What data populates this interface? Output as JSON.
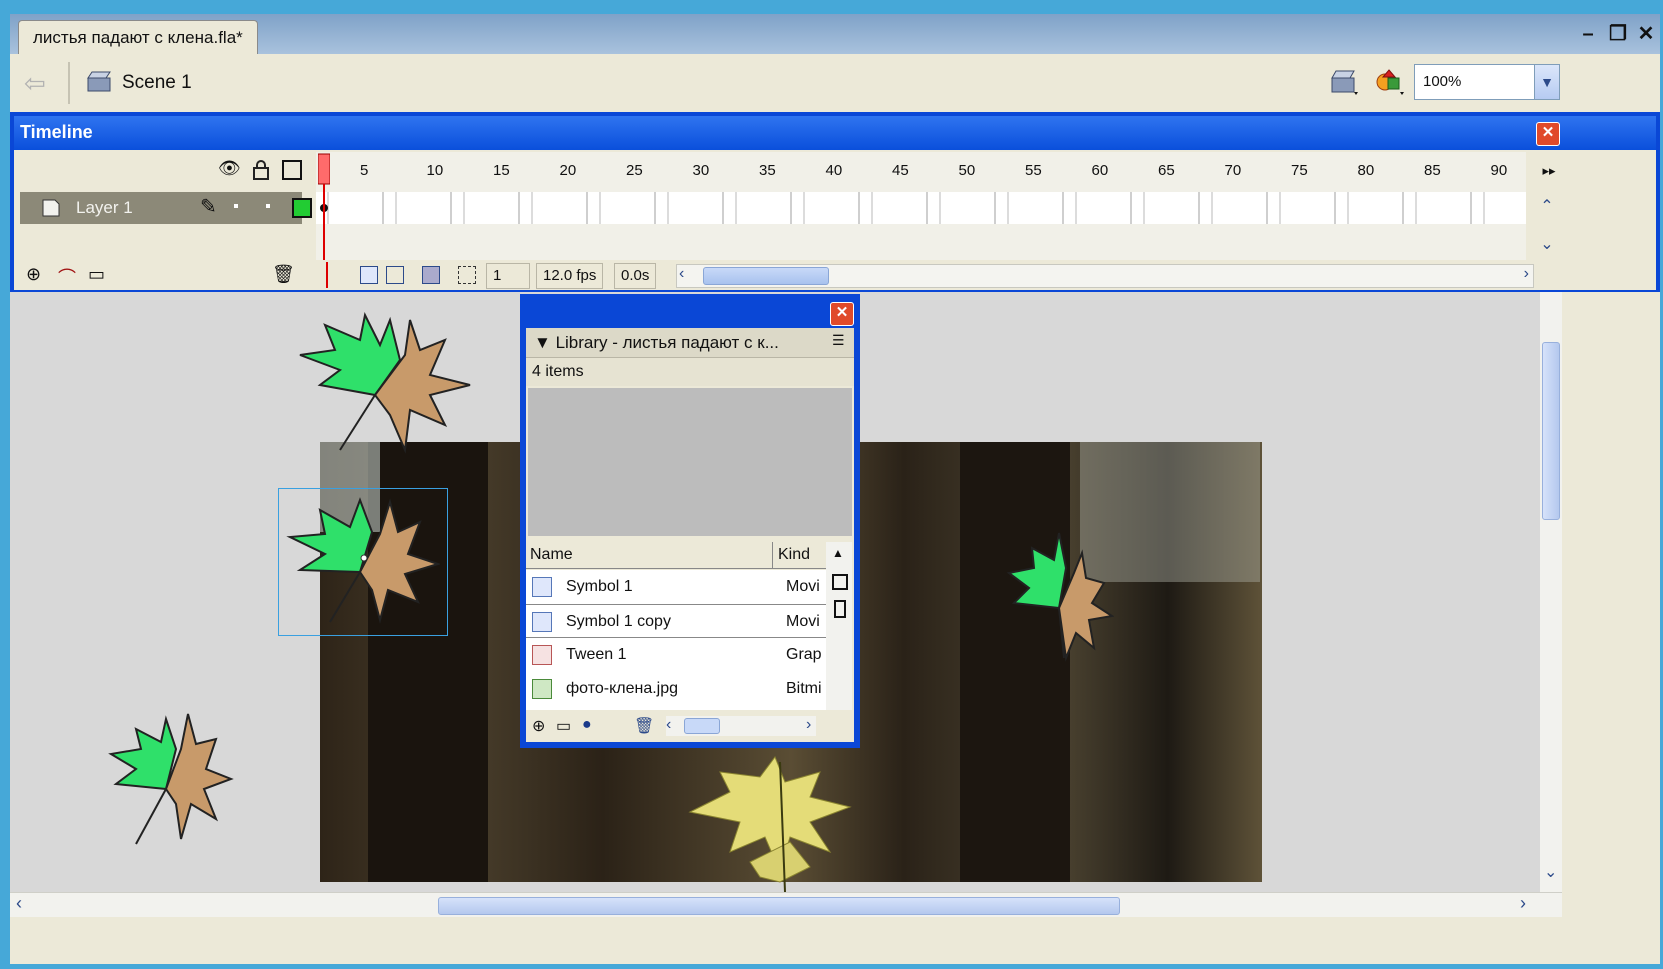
{
  "document": {
    "tab_title": "листья падают с клена.fla*"
  },
  "window_controls": {
    "minimize": "–",
    "restore": "❐",
    "close": "✕"
  },
  "edit_bar": {
    "scene_label": "Scene 1",
    "zoom_value": "100%"
  },
  "timeline": {
    "title": "Timeline",
    "frame_ticks": [
      "5",
      "10",
      "15",
      "20",
      "25",
      "30",
      "35",
      "40",
      "45",
      "50",
      "55",
      "60",
      "65",
      "70",
      "75",
      "80",
      "85",
      "90"
    ],
    "layer_name": "Layer 1",
    "current_frame": "1",
    "frame_rate": "12.0 fps",
    "elapsed_time": "0.0s"
  },
  "library": {
    "title": "Library - листья падают с к...",
    "item_count": "4 items",
    "columns": {
      "name": "Name",
      "kind": "Kind"
    },
    "items": [
      {
        "name": "Symbol 1",
        "kind": "Movi",
        "icon": "movieclip-icon"
      },
      {
        "name": "Symbol 1 copy",
        "kind": "Movi",
        "icon": "movieclip-icon"
      },
      {
        "name": "Tween 1",
        "kind": "Grap",
        "icon": "graphic-icon"
      },
      {
        "name": "фото-клена.jpg",
        "kind": "Bitmi",
        "icon": "bitmap-icon"
      }
    ]
  },
  "colors": {
    "panel_blue": "#0a47d6",
    "chrome": "#ece9d8",
    "stage_gray": "#d8d8d8",
    "leaf_green": "#2fe06a",
    "leaf_brown": "#c89a6a",
    "layer_box": "#22cc33"
  }
}
